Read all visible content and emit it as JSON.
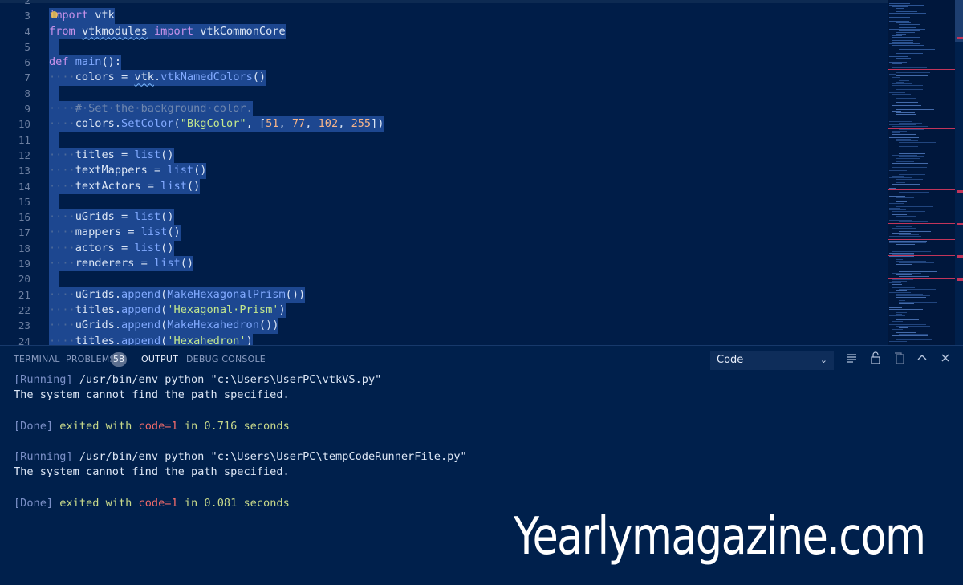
{
  "editor": {
    "lines": [
      {
        "n": "2",
        "parts": []
      },
      {
        "n": "3",
        "parts": [
          {
            "c": "kw",
            "t": "import"
          },
          {
            "c": "pl",
            "t": " vtk"
          }
        ]
      },
      {
        "n": "4",
        "parts": [
          {
            "c": "kw",
            "t": "from"
          },
          {
            "c": "pl",
            "t": " "
          },
          {
            "c": "pl squig",
            "t": "vtkmodules"
          },
          {
            "c": "pl",
            "t": " "
          },
          {
            "c": "kw",
            "t": "import"
          },
          {
            "c": "pl",
            "t": " vtkCommonCore"
          }
        ]
      },
      {
        "n": "5",
        "parts": []
      },
      {
        "n": "6",
        "parts": [
          {
            "c": "kw",
            "t": "def"
          },
          {
            "c": "pl",
            "t": " "
          },
          {
            "c": "fn",
            "t": "main"
          },
          {
            "c": "pl",
            "t": "():"
          }
        ]
      },
      {
        "n": "7",
        "parts": [
          {
            "c": "ws",
            "t": "····"
          },
          {
            "c": "pl",
            "t": "colors = "
          },
          {
            "c": "pl squig",
            "t": "vtk"
          },
          {
            "c": "pl",
            "t": "."
          },
          {
            "c": "fn",
            "t": "vtkNamedColors"
          },
          {
            "c": "pl",
            "t": "()"
          }
        ]
      },
      {
        "n": "8",
        "parts": []
      },
      {
        "n": "9",
        "parts": [
          {
            "c": "ws",
            "t": "····"
          },
          {
            "c": "cm",
            "t": "#·Set·the·background·color."
          }
        ]
      },
      {
        "n": "10",
        "parts": [
          {
            "c": "ws",
            "t": "····"
          },
          {
            "c": "pl",
            "t": "colors."
          },
          {
            "c": "fn",
            "t": "SetColor"
          },
          {
            "c": "pl",
            "t": "("
          },
          {
            "c": "str",
            "t": "\"BkgColor\""
          },
          {
            "c": "pl",
            "t": ", ["
          },
          {
            "c": "num",
            "t": "51"
          },
          {
            "c": "pl",
            "t": ", "
          },
          {
            "c": "num",
            "t": "77"
          },
          {
            "c": "pl",
            "t": ", "
          },
          {
            "c": "num",
            "t": "102"
          },
          {
            "c": "pl",
            "t": ", "
          },
          {
            "c": "num",
            "t": "255"
          },
          {
            "c": "pl",
            "t": "])"
          }
        ]
      },
      {
        "n": "11",
        "parts": []
      },
      {
        "n": "12",
        "parts": [
          {
            "c": "ws",
            "t": "····"
          },
          {
            "c": "pl",
            "t": "titles = "
          },
          {
            "c": "fn",
            "t": "list"
          },
          {
            "c": "pl",
            "t": "()"
          }
        ]
      },
      {
        "n": "13",
        "parts": [
          {
            "c": "ws",
            "t": "····"
          },
          {
            "c": "pl",
            "t": "textMappers = "
          },
          {
            "c": "fn",
            "t": "list"
          },
          {
            "c": "pl",
            "t": "()"
          }
        ]
      },
      {
        "n": "14",
        "parts": [
          {
            "c": "ws",
            "t": "····"
          },
          {
            "c": "pl",
            "t": "textActors = "
          },
          {
            "c": "fn",
            "t": "list"
          },
          {
            "c": "pl",
            "t": "()"
          }
        ]
      },
      {
        "n": "15",
        "parts": []
      },
      {
        "n": "16",
        "parts": [
          {
            "c": "ws",
            "t": "····"
          },
          {
            "c": "pl",
            "t": "uGrids = "
          },
          {
            "c": "fn",
            "t": "list"
          },
          {
            "c": "pl",
            "t": "()"
          }
        ]
      },
      {
        "n": "17",
        "parts": [
          {
            "c": "ws",
            "t": "····"
          },
          {
            "c": "pl",
            "t": "mappers = "
          },
          {
            "c": "fn",
            "t": "list"
          },
          {
            "c": "pl",
            "t": "()"
          }
        ]
      },
      {
        "n": "18",
        "parts": [
          {
            "c": "ws",
            "t": "····"
          },
          {
            "c": "pl",
            "t": "actors = "
          },
          {
            "c": "fn",
            "t": "list"
          },
          {
            "c": "pl",
            "t": "()"
          }
        ]
      },
      {
        "n": "19",
        "parts": [
          {
            "c": "ws",
            "t": "····"
          },
          {
            "c": "pl",
            "t": "renderers = "
          },
          {
            "c": "fn",
            "t": "list"
          },
          {
            "c": "pl",
            "t": "()"
          }
        ]
      },
      {
        "n": "20",
        "parts": []
      },
      {
        "n": "21",
        "parts": [
          {
            "c": "ws",
            "t": "····"
          },
          {
            "c": "pl",
            "t": "uGrids."
          },
          {
            "c": "fn",
            "t": "append"
          },
          {
            "c": "pl",
            "t": "("
          },
          {
            "c": "fn",
            "t": "MakeHexagonalPrism"
          },
          {
            "c": "pl",
            "t": "())"
          }
        ]
      },
      {
        "n": "22",
        "parts": [
          {
            "c": "ws",
            "t": "····"
          },
          {
            "c": "pl",
            "t": "titles."
          },
          {
            "c": "fn",
            "t": "append"
          },
          {
            "c": "pl",
            "t": "("
          },
          {
            "c": "str",
            "t": "'Hexagonal·Prism'"
          },
          {
            "c": "pl",
            "t": ")"
          }
        ]
      },
      {
        "n": "23",
        "parts": [
          {
            "c": "ws",
            "t": "····"
          },
          {
            "c": "pl",
            "t": "uGrids."
          },
          {
            "c": "fn",
            "t": "append"
          },
          {
            "c": "pl",
            "t": "("
          },
          {
            "c": "fn",
            "t": "MakeHexahedron"
          },
          {
            "c": "pl",
            "t": "())"
          }
        ]
      },
      {
        "n": "24",
        "parts": [
          {
            "c": "ws",
            "t": "····"
          },
          {
            "c": "pl",
            "t": "titles."
          },
          {
            "c": "fn",
            "t": "append"
          },
          {
            "c": "pl",
            "t": "("
          },
          {
            "c": "str",
            "t": "'Hexahedron'"
          },
          {
            "c": "pl",
            "t": ")"
          }
        ]
      }
    ]
  },
  "panel": {
    "tabs": [
      {
        "label": "TERMINAL",
        "active": false
      },
      {
        "label": "PROBLEMS",
        "active": false
      },
      {
        "label": "OUTPUT",
        "active": true
      },
      {
        "label": "DEBUG CONSOLE",
        "active": false
      }
    ],
    "problems_count": "58",
    "output_channel": "Code",
    "icons": [
      "list-filter-icon",
      "lock-icon",
      "clear-output-icon",
      "maximize-panel-icon",
      "close-panel-icon"
    ]
  },
  "output": [
    [
      {
        "c": "run",
        "t": "[Running]"
      },
      {
        "c": "txt",
        "t": " /usr/bin/env python \"c:\\Users\\UserPC\\vtkVS.py\""
      }
    ],
    [
      {
        "c": "txt",
        "t": "The system cannot find the path specified."
      }
    ],
    [],
    [
      {
        "c": "done",
        "t": "[Done]"
      },
      {
        "c": "ex",
        "t": " exited with "
      },
      {
        "c": "code1",
        "t": "code=1"
      },
      {
        "c": "ex",
        "t": " in "
      },
      {
        "c": "secs",
        "t": "0.716"
      },
      {
        "c": "ex",
        "t": " seconds"
      }
    ],
    [],
    [
      {
        "c": "run",
        "t": "[Running]"
      },
      {
        "c": "txt",
        "t": " /usr/bin/env python \"c:\\Users\\UserPC\\tempCodeRunnerFile.py\""
      }
    ],
    [
      {
        "c": "txt",
        "t": "The system cannot find the path specified."
      }
    ],
    [],
    [
      {
        "c": "done",
        "t": "[Done]"
      },
      {
        "c": "ex",
        "t": " exited with "
      },
      {
        "c": "code1",
        "t": "code=1"
      },
      {
        "c": "ex",
        "t": " in "
      },
      {
        "c": "secs",
        "t": "0.081"
      },
      {
        "c": "ex",
        "t": " seconds"
      }
    ]
  ],
  "watermark": "Yearlymagazine.com",
  "colors": {
    "background": "#00204c",
    "selection": "#1d4790",
    "error": "#c2355a"
  }
}
